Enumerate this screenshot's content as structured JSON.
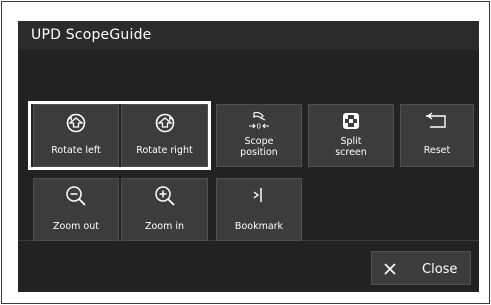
{
  "window": {
    "title": "UPD ScopeGuide"
  },
  "buttons": {
    "rotate_left": "Rotate left",
    "rotate_right": "Rotate right",
    "scope_position": "Scope\nposition",
    "split_screen": "Split\nscreen",
    "reset": "Reset",
    "zoom_out": "Zoom out",
    "zoom_in": "Zoom in",
    "bookmark": "Bookmark",
    "close": "Close"
  },
  "icons": {
    "rotate_left": "rotate-left-icon",
    "rotate_right": "rotate-right-icon",
    "scope_position": "scope-position-icon",
    "split_screen": "split-screen-icon",
    "reset": "reset-icon",
    "zoom_out": "zoom-out-icon",
    "zoom_in": "zoom-in-icon",
    "bookmark": "bookmark-icon",
    "close": "close-icon"
  },
  "colors": {
    "panel_background": "#222222",
    "title_bar": "#2b2b2b",
    "button_background": "#3c3c3c",
    "selection_outline": "#ffffff",
    "text": "#ffffff"
  },
  "state": {
    "selected_group": "rotation"
  }
}
